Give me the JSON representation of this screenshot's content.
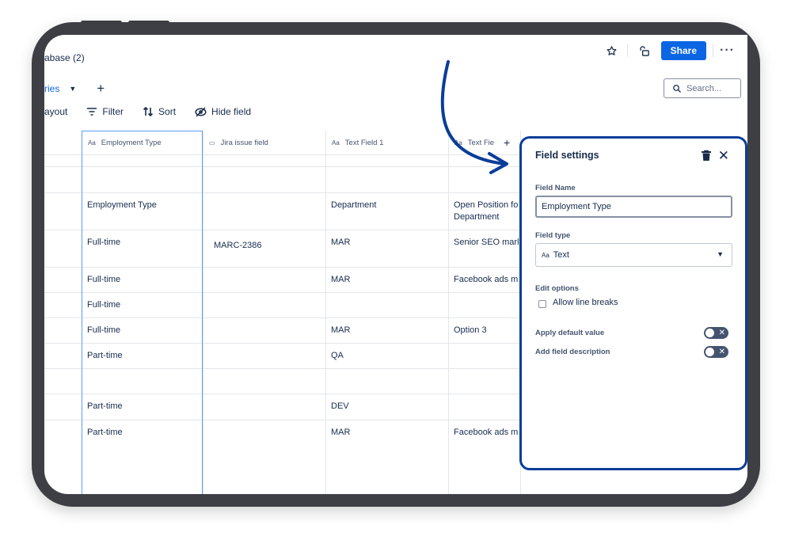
{
  "app": {
    "title": "abase (2)"
  },
  "header": {
    "share_label": "Share",
    "more_label": "···"
  },
  "tabs": {
    "active_label": "ries",
    "add_label": "+"
  },
  "search": {
    "placeholder": "Search..."
  },
  "toolbar": {
    "layout_label": "ayout",
    "filter_label": "Filter",
    "sort_label": "Sort",
    "hide_field_label": "Hide field"
  },
  "table": {
    "columns": [
      {
        "icon": "Aa",
        "label": "Employment Type"
      },
      {
        "icon": "▭",
        "label": "Jira issue field"
      },
      {
        "icon": "Aa",
        "label": "Text Field 1"
      },
      {
        "icon": "Aa",
        "label": "Text Fie"
      }
    ],
    "add_column_label": "+",
    "rows": [
      [
        "",
        "",
        "",
        ""
      ],
      [
        "Employment Type",
        "",
        "Department",
        "Open Position fo\nDepartment"
      ],
      [
        "Full-time",
        "MARC-2386",
        "MAR",
        "Senior SEO mark"
      ],
      [
        "Full-time",
        "",
        "MAR",
        "Facebook ads m"
      ],
      [
        "Full-time",
        "",
        "",
        ""
      ],
      [
        "Full-time",
        "",
        "MAR",
        "Option 3"
      ],
      [
        "Part-time",
        "",
        "QA",
        ""
      ],
      [
        "",
        "",
        "",
        ""
      ],
      [
        "Part-time",
        "",
        "DEV",
        ""
      ],
      [
        "Part-time",
        "",
        "MAR",
        "Facebook ads m"
      ]
    ]
  },
  "panel": {
    "title": "Field settings",
    "field_name_label": "Field Name",
    "field_name_value": "Employment Type",
    "field_type_label": "Field type",
    "field_type_icon": "Aa",
    "field_type_value": "Text",
    "edit_options_label": "Edit options",
    "allow_line_breaks_label": "Allow line breaks",
    "allow_line_breaks_checked": false,
    "apply_default_label": "Apply default value",
    "apply_default_on": false,
    "add_description_label": "Add field description",
    "add_description_on": false
  },
  "colors": {
    "accent": "#0c66e4",
    "panel_border": "#0a3d99",
    "selected_column": "#579dff"
  }
}
